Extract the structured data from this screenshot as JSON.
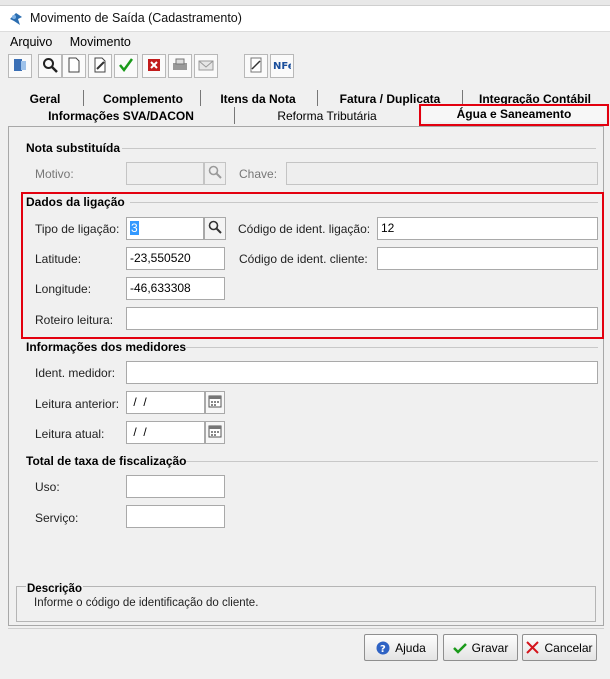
{
  "window": {
    "title": "Movimento de Saída (Cadastramento)"
  },
  "menu": {
    "items": [
      "Arquivo",
      "Movimento"
    ]
  },
  "toolbar": {
    "buttons": [
      "exit-icon",
      "search-icon",
      "new-document-icon",
      "edit-icon",
      "confirm-check-icon",
      "delete-icon",
      "print-icon",
      "mail-icon",
      "signature-icon",
      "nfe-icon"
    ]
  },
  "tabs": {
    "row1": [
      "Geral",
      "Complemento",
      "Itens da Nota",
      "Fatura / Duplicata",
      "Integração Contábil"
    ],
    "row2": [
      "Informações SVA/DACON",
      "Reforma Tributária",
      "Água e Saneamento"
    ],
    "active": "Água e Saneamento"
  },
  "nota_substituida": {
    "heading": "Nota substituída",
    "motivo_label": "Motivo:",
    "motivo_value": "",
    "chave_label": "Chave:",
    "chave_value": ""
  },
  "dados_ligacao": {
    "heading": "Dados da ligação",
    "tipo_label": "Tipo de ligação:",
    "tipo_value": "3",
    "cod_lig_label": "Código de ident. ligação:",
    "cod_lig_value": "12",
    "latitude_label": "Latitude:",
    "latitude_value": "-23,550520",
    "cod_cli_label": "Código de ident. cliente:",
    "cod_cli_value": "",
    "longitude_label": "Longitude:",
    "longitude_value": "-46,633308",
    "roteiro_label": "Roteiro leitura:",
    "roteiro_value": ""
  },
  "medidores": {
    "heading": "Informações dos medidores",
    "ident_label": "Ident. medidor:",
    "ident_value": "",
    "anterior_label": "Leitura anterior:",
    "anterior_value": " /  /",
    "atual_label": "Leitura atual:",
    "atual_value": " /  /"
  },
  "taxa": {
    "heading": "Total de taxa de fiscalização",
    "uso_label": "Uso:",
    "uso_value": "",
    "servico_label": "Serviço:",
    "servico_value": ""
  },
  "descricao": {
    "title": "Descrição",
    "text": "Informe o código de identificação do cliente."
  },
  "buttons": {
    "ajuda": "Ajuda",
    "gravar": "Gravar",
    "cancelar": "Cancelar"
  },
  "colors": {
    "highlight_border": "#e3000f",
    "selection": "#3399ff"
  }
}
